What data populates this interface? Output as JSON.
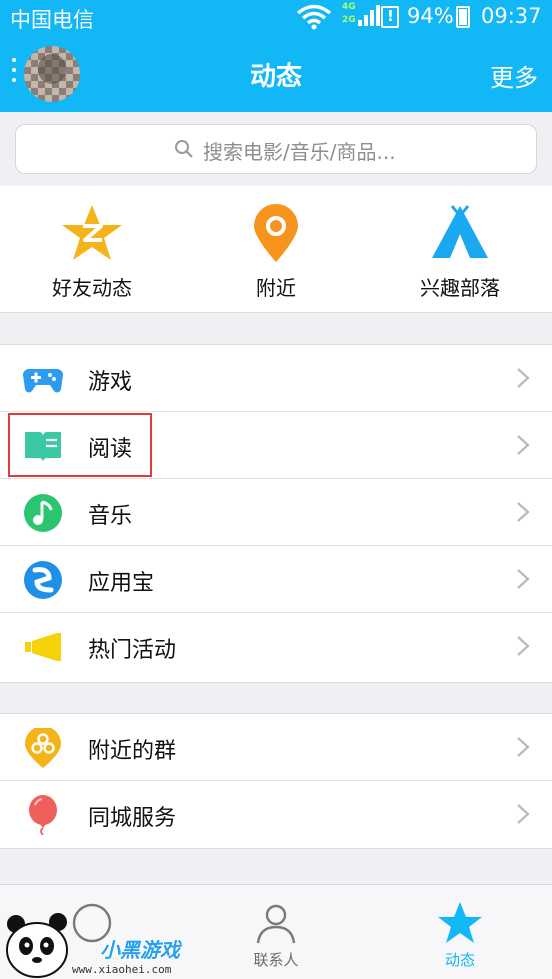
{
  "status_bar": {
    "carrier": "中国电信",
    "network_top": "4G",
    "network_bottom": "2G",
    "battery": "94%",
    "time": "09:37"
  },
  "header": {
    "title": "动态",
    "more": "更多"
  },
  "search": {
    "placeholder": "搜索电影/音乐/商品..."
  },
  "quick_actions": [
    {
      "label": "好友动态",
      "icon": "star-z-icon",
      "color": "#f5b31a"
    },
    {
      "label": "附近",
      "icon": "location-pin-icon",
      "color": "#f7941d"
    },
    {
      "label": "兴趣部落",
      "icon": "tent-icon",
      "color": "#1aa8f0"
    }
  ],
  "list_group_1": [
    {
      "label": "游戏",
      "icon": "gamepad-icon",
      "color": "#2b9cf0"
    },
    {
      "label": "阅读",
      "icon": "book-icon",
      "color": "#3cc7a5"
    },
    {
      "label": "音乐",
      "icon": "music-note-icon",
      "color": "#2cc56f"
    },
    {
      "label": "应用宝",
      "icon": "app-store-icon",
      "color": "#1e90e8"
    },
    {
      "label": "热门活动",
      "icon": "megaphone-icon",
      "color": "#f5d20a"
    }
  ],
  "list_group_2": [
    {
      "label": "附近的群",
      "icon": "nearby-group-icon",
      "color": "#f5b31a"
    },
    {
      "label": "同城服务",
      "icon": "balloon-icon",
      "color": "#f0605a"
    }
  ],
  "tabs": [
    {
      "label": "",
      "icon": "messages-icon"
    },
    {
      "label": "联系人",
      "icon": "contacts-icon"
    },
    {
      "label": "动态",
      "icon": "star-tab-icon",
      "active": true
    }
  ],
  "watermark": {
    "brand": "小黑游戏",
    "url": "www.xiaohei.com"
  },
  "colors": {
    "primary": "#12b7f5",
    "background": "#efeff4",
    "highlight_box": "#e23b3b"
  }
}
